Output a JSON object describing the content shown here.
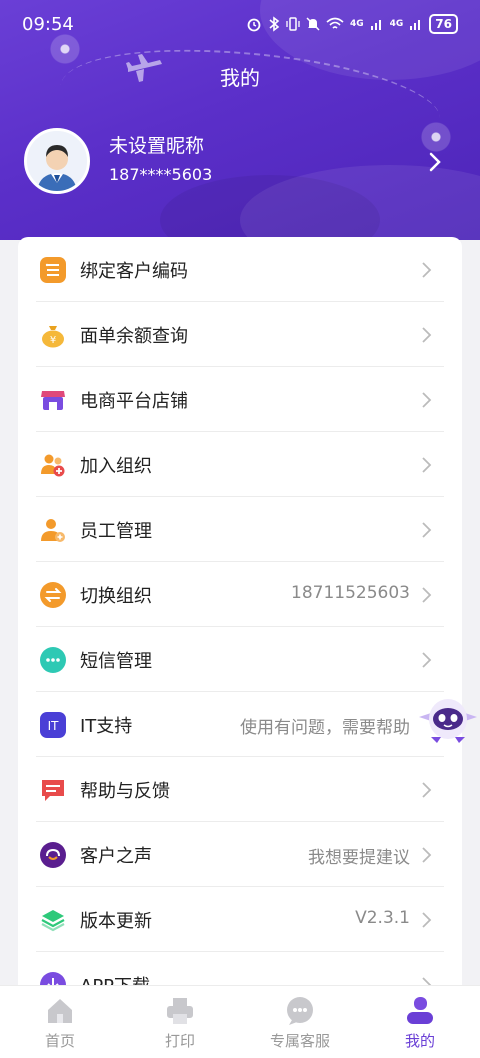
{
  "status_bar": {
    "time": "09:54",
    "network_1": "4G",
    "network_2": "4G",
    "battery": "76"
  },
  "header": {
    "title": "我的",
    "nickname": "未设置昵称",
    "phone": "187****5603"
  },
  "menu": [
    {
      "label": "绑定客户编码",
      "value": "",
      "icon": "list-icon"
    },
    {
      "label": "面单余额查询",
      "value": "",
      "icon": "money-bag-icon"
    },
    {
      "label": "电商平台店铺",
      "value": "",
      "icon": "store-icon"
    },
    {
      "label": "加入组织",
      "value": "",
      "icon": "join-group-icon"
    },
    {
      "label": "员工管理",
      "value": "",
      "icon": "employee-icon"
    },
    {
      "label": "切换组织",
      "value": "18711525603",
      "icon": "switch-icon"
    },
    {
      "label": "短信管理",
      "value": "",
      "icon": "sms-icon"
    },
    {
      "label": "IT支持",
      "value": "使用有问题，需要帮助",
      "icon": "it-support-icon",
      "icon_text": "IT"
    },
    {
      "label": "帮助与反馈",
      "value": "",
      "icon": "feedback-icon"
    },
    {
      "label": "客户之声",
      "value": "我想要提建议",
      "icon": "customer-voice-icon"
    },
    {
      "label": "版本更新",
      "value": "V2.3.1",
      "icon": "layers-icon"
    },
    {
      "label": "APP下载",
      "value": "",
      "icon": "download-icon"
    }
  ],
  "tabbar": [
    {
      "label": "首页",
      "icon": "home-icon",
      "active": false
    },
    {
      "label": "打印",
      "icon": "printer-icon",
      "active": false
    },
    {
      "label": "专属客服",
      "icon": "chat-icon",
      "active": false
    },
    {
      "label": "我的",
      "icon": "profile-icon",
      "active": true
    }
  ],
  "colors": {
    "header": "#5b2fc9",
    "accent": "#6a3fd6",
    "orange": "#f39a2b"
  }
}
